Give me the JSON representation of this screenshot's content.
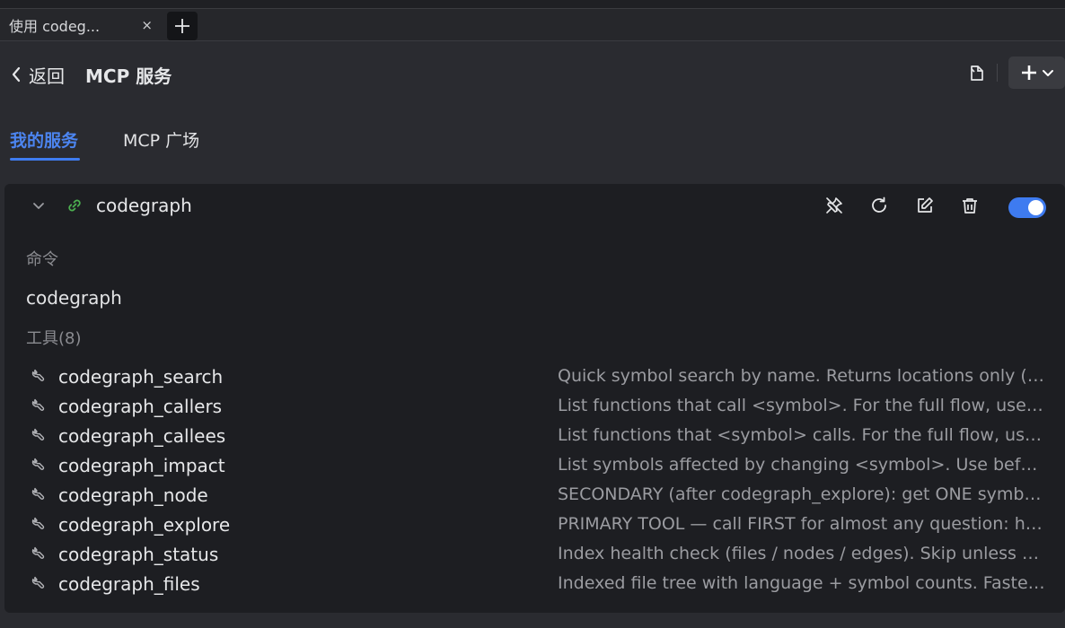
{
  "browser": {
    "tab_title": "使用 codeg...",
    "tab_close": "×"
  },
  "header": {
    "back_label": "返回",
    "title": "MCP 服务"
  },
  "tabs": [
    {
      "label": "我的服务",
      "active": true
    },
    {
      "label": "MCP 广场",
      "active": false
    }
  ],
  "server": {
    "name": "codegraph",
    "enabled": true,
    "command_label": "命令",
    "command_value": "codegraph",
    "tools_label": "工具(8)",
    "tools": [
      {
        "name": "codegraph_search",
        "description": "Quick symbol search by name. Returns locations only (no code). Use codegraph_node for full code."
      },
      {
        "name": "codegraph_callers",
        "description": "List functions that call <symbol>. For the full flow, use codegraph_explore instead."
      },
      {
        "name": "codegraph_callees",
        "description": "List functions that <symbol> calls. For the full flow, use codegraph_explore instead."
      },
      {
        "name": "codegraph_impact",
        "description": "List symbols affected by changing <symbol>. Use before refactoring to assess risk."
      },
      {
        "name": "codegraph_node",
        "description": "SECONDARY (after codegraph_explore): get ONE symbol with its full source code."
      },
      {
        "name": "codegraph_explore",
        "description": "PRIMARY TOOL — call FIRST for almost any question: how does X work, where is Y."
      },
      {
        "name": "codegraph_status",
        "description": "Index health check (files / nodes / edges). Skip unless debugging the index."
      },
      {
        "name": "codegraph_files",
        "description": "Indexed file tree with language + symbol counts. Faster than listing directories."
      }
    ]
  },
  "colors": {
    "accent": "#3f7cf0",
    "link_icon": "#4caf50",
    "background": "#2a2b30",
    "card": "#1d1e22"
  },
  "icons": [
    "chevron-left-icon",
    "document-icon",
    "plus-icon",
    "chevron-down-icon",
    "link-icon",
    "pin-off-icon",
    "refresh-icon",
    "edit-icon",
    "trash-icon",
    "wrench-icon",
    "close-icon"
  ]
}
